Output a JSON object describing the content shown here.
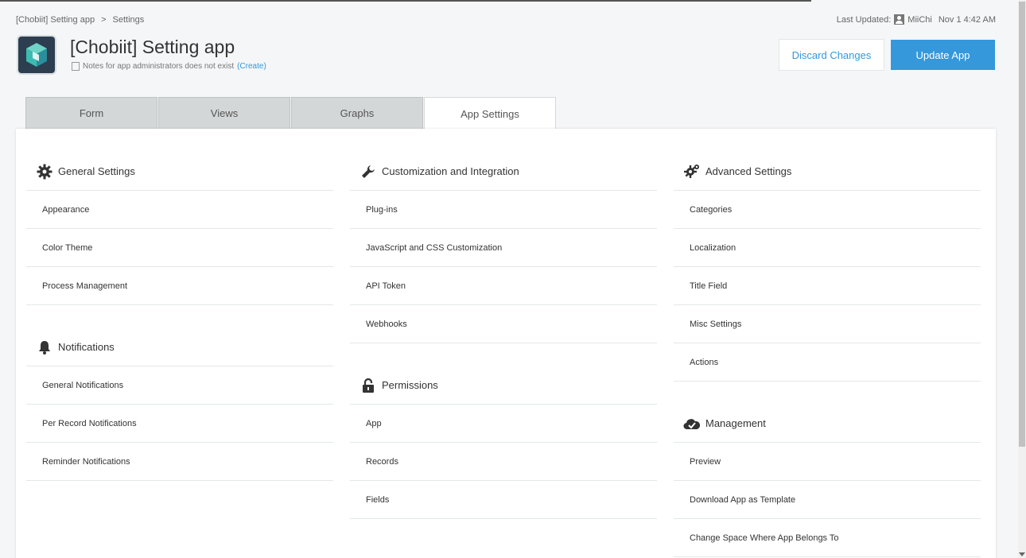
{
  "breadcrumb": {
    "app": "[Chobiit] Setting app",
    "separator": ">",
    "current": "Settings"
  },
  "last_updated": {
    "label": "Last Updated:",
    "user": "MiiChi",
    "time": "Nov 1 4:42 AM"
  },
  "app": {
    "title": "[Chobiit] Setting app",
    "notes_text": "Notes for app administrators does not exist",
    "notes_link": "(Create)"
  },
  "buttons": {
    "discard": "Discard Changes",
    "update": "Update App"
  },
  "tabs": [
    {
      "label": "Form"
    },
    {
      "label": "Views"
    },
    {
      "label": "Graphs"
    },
    {
      "label": "App Settings",
      "active": true
    }
  ],
  "columns": {
    "general": {
      "title": "General Settings",
      "icon": "gear-icon",
      "items": [
        "Appearance",
        "Color Theme",
        "Process Management"
      ]
    },
    "notifications": {
      "title": "Notifications",
      "icon": "bell-icon",
      "items": [
        "General Notifications",
        "Per Record Notifications",
        "Reminder Notifications"
      ]
    },
    "customization": {
      "title": "Customization and Integration",
      "icon": "wrench-icon",
      "items": [
        "Plug-ins",
        "JavaScript and CSS Customization",
        "API Token",
        "Webhooks"
      ]
    },
    "permissions": {
      "title": "Permissions",
      "icon": "lock-icon",
      "items": [
        "App",
        "Records",
        "Fields"
      ]
    },
    "advanced": {
      "title": "Advanced Settings",
      "icon": "gears-icon",
      "items": [
        "Categories",
        "Localization",
        "Title Field",
        "Misc Settings",
        "Actions"
      ]
    },
    "management": {
      "title": "Management",
      "icon": "cloud-check-icon",
      "items": [
        "Preview",
        "Download App as Template",
        "Change Space Where App Belongs To"
      ]
    }
  },
  "colors": {
    "accent": "#3498db",
    "app_icon_bg": "#2c3e50",
    "app_icon_teal": "#3dbbb0"
  }
}
